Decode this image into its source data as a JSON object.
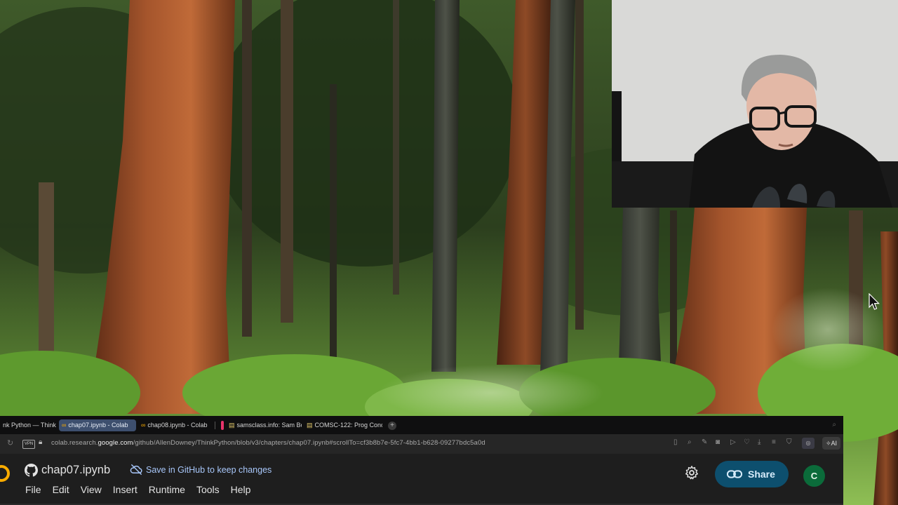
{
  "browser": {
    "tabs": [
      {
        "label": "nk Python — Think Py",
        "icon": "book-icon",
        "active": false
      },
      {
        "label": "chap07.ipynb - Colab",
        "icon": "colab-icon",
        "active": true
      },
      {
        "label": "chap08.ipynb - Colab",
        "icon": "colab-icon",
        "active": false
      },
      {
        "label": "samsclass.info: Sam Bo",
        "icon": "doc-icon",
        "active": false
      },
      {
        "label": "COMSC-122: Prog Conc",
        "icon": "doc-icon",
        "active": false
      }
    ],
    "new_tab_icon": "+",
    "url_prefix": "colab.research.",
    "url_domain": "google.com",
    "url_path": "/github/AllenDowney/ThinkPython/blob/v3/chapters/chap07.ipynb#scrollTo=cf3b8b7e-5fc7-4bb1-b628-09277bdc5a0d",
    "vpn_label": "VPN",
    "ai_button": "AI"
  },
  "colab": {
    "notebook_title": "chap07.ipynb",
    "save_message": "Save in GitHub to keep changes",
    "menu": [
      "File",
      "Edit",
      "View",
      "Insert",
      "Runtime",
      "Tools",
      "Help"
    ],
    "share_label": "Share",
    "avatar_letter": "C",
    "accent_color": "#f9ab00",
    "share_color": "#0d4f6e"
  }
}
